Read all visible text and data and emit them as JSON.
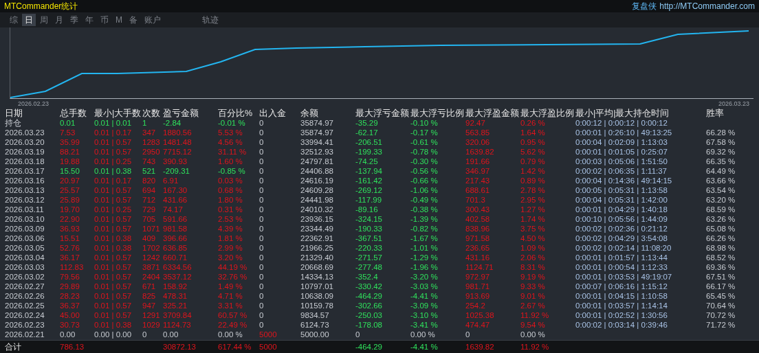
{
  "header": {
    "title": "MTCommander统计",
    "brand": "复盘侠",
    "url": "http://MTCommander.com"
  },
  "tabs": [
    {
      "label": "综",
      "selected": false
    },
    {
      "label": "日",
      "selected": true
    },
    {
      "label": "周",
      "selected": false
    },
    {
      "label": "月",
      "selected": false
    },
    {
      "label": "季",
      "selected": false
    },
    {
      "label": "年",
      "selected": false
    },
    {
      "label": "币",
      "selected": false
    },
    {
      "label": "M",
      "selected": false
    },
    {
      "label": "备",
      "selected": false
    },
    {
      "label": "账户",
      "selected": false
    },
    {
      "label": "轨迹",
      "selected": false
    }
  ],
  "chart": {
    "start_label": "2026.02.23",
    "end_label": "2026.03.23"
  },
  "table": {
    "columns": [
      "日期",
      "总手数",
      "最小|大手数",
      "次数",
      "盈亏金额",
      "百分比%",
      "出入金",
      "余额",
      "最大浮亏金额",
      "最大浮亏比例",
      "最大浮盈金额",
      "最大浮盈比例",
      "最小|平均|最大持仓时间",
      "胜率"
    ],
    "rows": [
      {
        "kind": "loss",
        "cells": [
          "持仓",
          "0.01",
          "0.01 | 0.01",
          "1",
          "-2.84",
          "-0.01 %",
          "0",
          "35874.97",
          "-35.29",
          "-0.10 %",
          "92.47",
          "0.26 %",
          "0:00:12 | 0:00:12 | 0:00:12",
          ""
        ]
      },
      {
        "kind": "profit",
        "cells": [
          "2026.03.23",
          "7.53",
          "0.01 | 0.17",
          "347",
          "1880.56",
          "5.53 %",
          "0",
          "35874.97",
          "-62.17",
          "-0.17 %",
          "563.85",
          "1.64 %",
          "0:00:01 | 0:26:10 | 49:13:25",
          "66.28 %"
        ]
      },
      {
        "kind": "profit",
        "cells": [
          "2026.03.20",
          "35.99",
          "0.01 | 0.57",
          "1283",
          "1481.48",
          "4.56 %",
          "0",
          "33994.41",
          "-206.51",
          "-0.61 %",
          "320.06",
          "0.95 %",
          "0:00:04 | 0:02:09 | 1:13:03",
          "67.58 %"
        ]
      },
      {
        "kind": "profit",
        "cells": [
          "2026.03.19",
          "88.21",
          "0.01 | 0.57",
          "2950",
          "7715.12",
          "31.11 %",
          "0",
          "32512.93",
          "-199.33",
          "-0.78 %",
          "1639.82",
          "5.62 %",
          "0:00:01 | 0:01:05 | 0:25:07",
          "69.32 %"
        ]
      },
      {
        "kind": "profit",
        "cells": [
          "2026.03.18",
          "19.88",
          "0.01 | 0.25",
          "743",
          "390.93",
          "1.60 %",
          "0",
          "24797.81",
          "-74.25",
          "-0.30 %",
          "191.66",
          "0.79 %",
          "0:00:03 | 0:05:06 | 1:51:50",
          "66.35 %"
        ]
      },
      {
        "kind": "loss",
        "cells": [
          "2026.03.17",
          "15.50",
          "0.01 | 0.38",
          "521",
          "-209.31",
          "-0.85 %",
          "0",
          "24406.88",
          "-137.94",
          "-0.56 %",
          "346.97",
          "1.42 %",
          "0:00:02 | 0:06:35 | 1:11:37",
          "64.49 %"
        ]
      },
      {
        "kind": "profit",
        "cells": [
          "2026.03.16",
          "20.97",
          "0.01 | 0.17",
          "820",
          "6.91",
          "0.03 %",
          "0",
          "24616.19",
          "-161.42",
          "-0.66 %",
          "217.43",
          "0.89 %",
          "0:00:04 | 0:14:36 | 49:14:15",
          "63.66 %"
        ]
      },
      {
        "kind": "profit",
        "cells": [
          "2026.03.13",
          "25.57",
          "0.01 | 0.57",
          "694",
          "167.30",
          "0.68 %",
          "0",
          "24609.28",
          "-269.12",
          "-1.06 %",
          "688.61",
          "2.78 %",
          "0:00:05 | 0:05:31 | 1:13:58",
          "63.54 %"
        ]
      },
      {
        "kind": "profit",
        "cells": [
          "2026.03.12",
          "25.89",
          "0.01 | 0.57",
          "712",
          "431.66",
          "1.80 %",
          "0",
          "24441.98",
          "-117.99",
          "-0.49 %",
          "701.3",
          "2.95 %",
          "0:00:04 | 0:05:31 | 1:42:00",
          "63.20 %"
        ]
      },
      {
        "kind": "profit",
        "cells": [
          "2026.03.11",
          "19.70",
          "0.01 | 0.25",
          "729",
          "74.17",
          "0.31 %",
          "0",
          "24010.32",
          "-89.16",
          "-0.38 %",
          "300.43",
          "1.27 %",
          "0:00:01 | 0:04:29 | 1:40:18",
          "68.59 %"
        ]
      },
      {
        "kind": "profit",
        "cells": [
          "2026.03.10",
          "22.90",
          "0.01 | 0.57",
          "705",
          "591.66",
          "2.53 %",
          "0",
          "23936.15",
          "-324.15",
          "-1.39 %",
          "402.58",
          "1.74 %",
          "0:00:10 | 0:05:56 | 1:44:09",
          "63.26 %"
        ]
      },
      {
        "kind": "profit",
        "cells": [
          "2026.03.09",
          "36.93",
          "0.01 | 0.57",
          "1071",
          "981.58",
          "4.39 %",
          "0",
          "23344.49",
          "-190.33",
          "-0.82 %",
          "838.96",
          "3.75 %",
          "0:00:02 | 0:02:36 | 0:21:12",
          "65.08 %"
        ]
      },
      {
        "kind": "profit",
        "cells": [
          "2026.03.06",
          "15.51",
          "0.01 | 0.38",
          "409",
          "396.66",
          "1.81 %",
          "0",
          "22362.91",
          "-367.51",
          "-1.67 %",
          "971.58",
          "4.50 %",
          "0:00:02 | 0:04:29 | 3:54:08",
          "66.26 %"
        ]
      },
      {
        "kind": "profit",
        "cells": [
          "2026.03.05",
          "52.76",
          "0.01 | 0.38",
          "1702",
          "636.85",
          "2.99 %",
          "0",
          "21966.25",
          "-220.33",
          "-1.01 %",
          "236.65",
          "1.09 %",
          "0:00:02 | 0:02:14 | 11:08:20",
          "68.98 %"
        ]
      },
      {
        "kind": "profit",
        "cells": [
          "2026.03.04",
          "36.17",
          "0.01 | 0.57",
          "1242",
          "660.71",
          "3.20 %",
          "0",
          "21329.40",
          "-271.57",
          "-1.29 %",
          "431.16",
          "2.06 %",
          "0:00:01 | 0:01:57 | 1:13:44",
          "68.52 %"
        ]
      },
      {
        "kind": "profit",
        "cells": [
          "2026.03.03",
          "112.83",
          "0.01 | 0.57",
          "3871",
          "6334.56",
          "44.19 %",
          "0",
          "20668.69",
          "-277.48",
          "-1.96 %",
          "1124.71",
          "8.31 %",
          "0:00:01 | 0:00:54 | 1:12:33",
          "69.36 %"
        ]
      },
      {
        "kind": "profit",
        "cells": [
          "2026.03.02",
          "79.56",
          "0.01 | 0.57",
          "2404",
          "3537.12",
          "32.76 %",
          "0",
          "14334.13",
          "-352.4",
          "-3.20 %",
          "972.97",
          "9.19 %",
          "0:00:01 | 0:03:53 | 49:19:07",
          "67.51 %"
        ]
      },
      {
        "kind": "profit",
        "cells": [
          "2026.02.27",
          "29.89",
          "0.01 | 0.57",
          "671",
          "158.92",
          "1.49 %",
          "0",
          "10797.01",
          "-330.42",
          "-3.03 %",
          "981.71",
          "9.33 %",
          "0:00:07 | 0:06:16 | 1:15:12",
          "66.17 %"
        ]
      },
      {
        "kind": "profit",
        "cells": [
          "2026.02.26",
          "28.23",
          "0.01 | 0.57",
          "825",
          "478.31",
          "4.71 %",
          "0",
          "10638.09",
          "-464.29",
          "-4.41 %",
          "913.69",
          "9.01 %",
          "0:00:01 | 0:04:15 | 1:10:58",
          "65.45 %"
        ]
      },
      {
        "kind": "profit",
        "cells": [
          "2026.02.25",
          "36.37",
          "0.01 | 0.57",
          "947",
          "325.21",
          "3.31 %",
          "0",
          "10159.78",
          "-302.66",
          "-3.09 %",
          "254.2",
          "2.67 %",
          "0:00:01 | 0:03:57 | 1:14:14",
          "70.64 %"
        ]
      },
      {
        "kind": "profit",
        "cells": [
          "2026.02.24",
          "45.00",
          "0.01 | 0.57",
          "1291",
          "3709.84",
          "60.57 %",
          "0",
          "9834.57",
          "-250.03",
          "-3.10 %",
          "1025.38",
          "11.92 %",
          "0:00:01 | 0:02:52 | 1:30:56",
          "70.72 %"
        ]
      },
      {
        "kind": "profit",
        "cells": [
          "2026.02.23",
          "30.73",
          "0.01 | 0.38",
          "1029",
          "1124.73",
          "22.49 %",
          "0",
          "6124.73",
          "-178.08",
          "-3.41 %",
          "474.47",
          "9.54 %",
          "0:00:02 | 0:03:14 | 0:39:46",
          "71.72 %"
        ]
      },
      {
        "kind": "flat",
        "cells": [
          "2026.02.21",
          "0.00",
          "0.00 | 0.00",
          "0",
          "0.00",
          "0.00 %",
          "5000",
          "5000.00",
          "0",
          "0.00 %",
          "0",
          "0.00 %",
          "",
          ""
        ]
      }
    ],
    "total": {
      "cells": [
        "合计",
        "786.13",
        "",
        "",
        "30872.13",
        "617.44 %",
        "5000",
        "",
        "-464.29",
        "-4.41 %",
        "1639.82",
        "11.92 %",
        "",
        ""
      ]
    }
  }
}
